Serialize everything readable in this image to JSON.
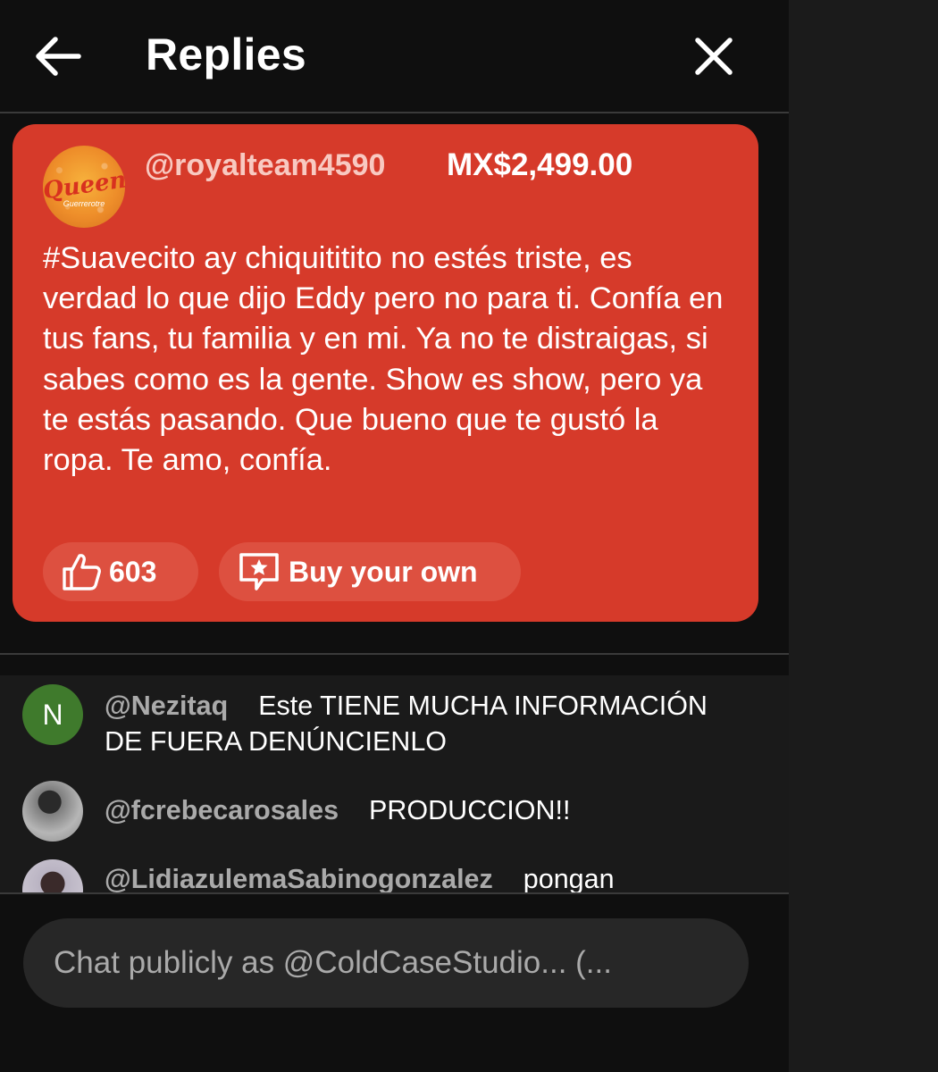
{
  "header": {
    "title": "Replies",
    "back_icon": "arrow-left-icon",
    "close_icon": "close-icon"
  },
  "super_chat": {
    "avatar_text": "Queen",
    "avatar_subtext": "Guerrerotre",
    "username": "@royalteam4590",
    "amount": "MX$2,499.00",
    "message": "#Suavecito ay chiquititito no estés triste, es verdad lo que dijo Eddy pero no para ti. Confía en tus fans, tu familia y en mi. Ya no te distraigas, si sabes como es la gente. Show es show, pero ya te estás pasando. Que bueno que te gustó la ropa. Te amo, confía.",
    "like_count": "603",
    "buy_label": "Buy your own",
    "background_color": "#d63a2a"
  },
  "comments": [
    {
      "avatar_letter": "N",
      "avatar_color": "#3f7a2c",
      "username": "@Nezitaq",
      "text": "Este TIENE MUCHA INFORMACIÓN DE FUERA DENÚNCIENLO"
    },
    {
      "avatar_letter": "",
      "avatar_color": "#9a9a9a",
      "username": "@fcrebecarosales",
      "text": "PRODUCCION!!"
    },
    {
      "avatar_letter": "",
      "avatar_color": "#c9c2cc",
      "username": "@LidiazulemaSabinogonzalez",
      "text": "pongan"
    }
  ],
  "chat_input": {
    "placeholder": "Chat publicly as @ColdCaseStudio... (..."
  }
}
